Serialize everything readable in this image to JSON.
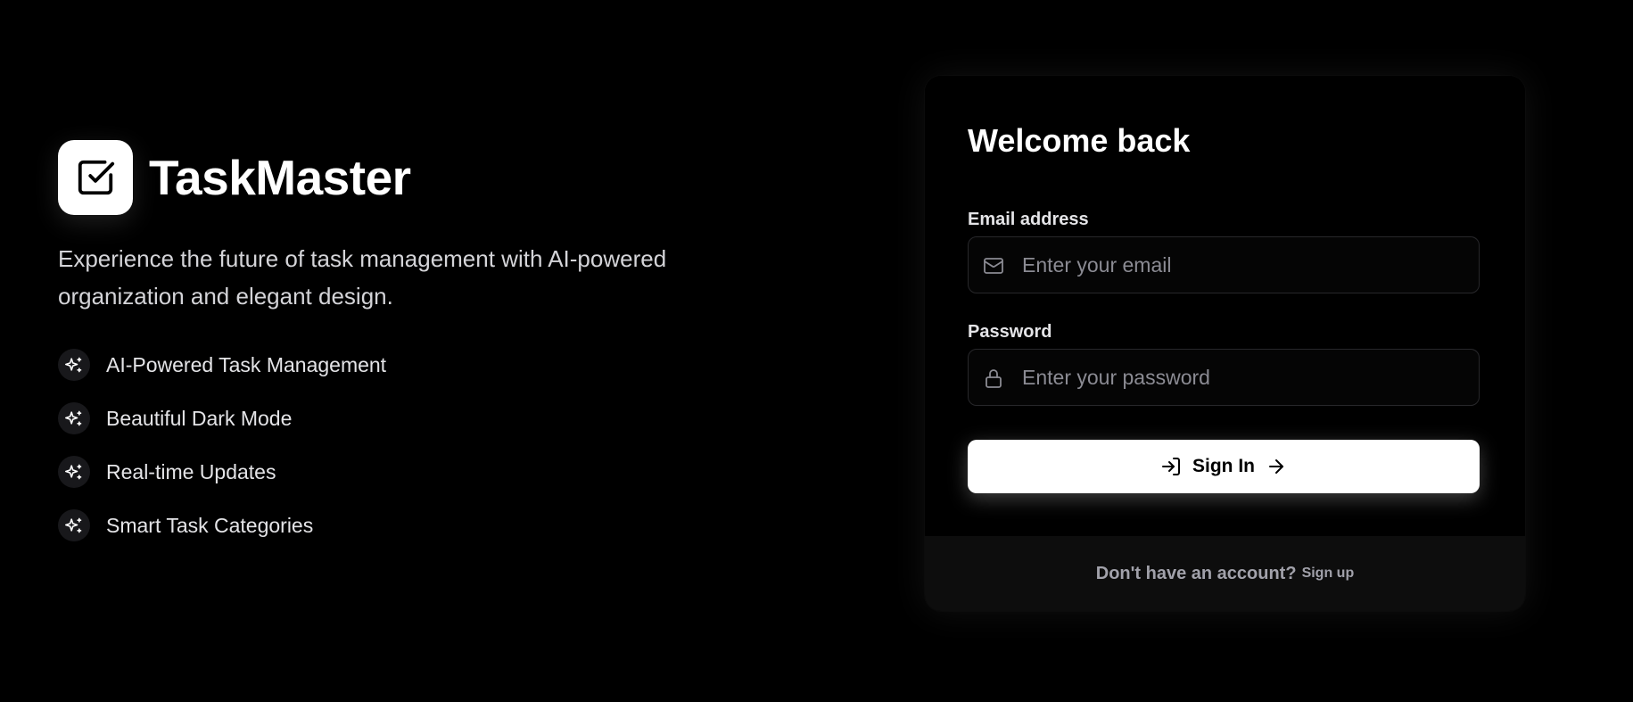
{
  "brand": {
    "app_name": "TaskMaster",
    "logo_icon": "check-square-icon",
    "tagline": "Experience the future of task management with AI-powered organization and elegant design."
  },
  "features": [
    {
      "icon": "sparkles-icon",
      "label": "AI-Powered Task Management"
    },
    {
      "icon": "sparkles-icon",
      "label": "Beautiful Dark Mode"
    },
    {
      "icon": "sparkles-icon",
      "label": "Real-time Updates"
    },
    {
      "icon": "sparkles-icon",
      "label": "Smart Task Categories"
    }
  ],
  "login": {
    "title": "Welcome back",
    "email": {
      "label": "Email address",
      "placeholder": "Enter your email",
      "value": "",
      "icon": "mail-icon"
    },
    "password": {
      "label": "Password",
      "placeholder": "Enter your password",
      "value": "",
      "icon": "lock-icon"
    },
    "submit": {
      "label": "Sign In",
      "leading_icon": "log-in-icon",
      "trailing_icon": "arrow-right-icon"
    },
    "footer": {
      "prompt": "Don't have an account?",
      "link_label": "Sign up"
    }
  },
  "colors": {
    "background": "#000000",
    "card_footer": "#0d0d0d",
    "input_border": "#27272a",
    "primary_button": "#ffffff",
    "muted_text": "#a1a1aa"
  }
}
